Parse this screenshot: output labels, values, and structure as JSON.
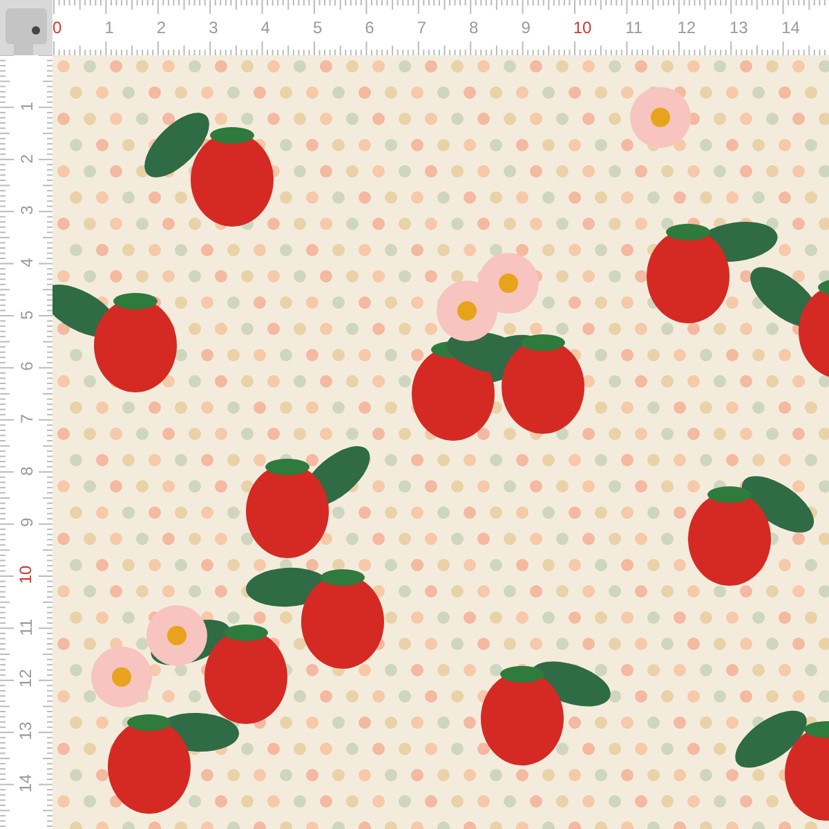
{
  "ruler_top": {
    "marks": [
      {
        "label": "0",
        "highlighted": true
      },
      {
        "label": "1",
        "highlighted": false
      },
      {
        "label": "2",
        "highlighted": false
      },
      {
        "label": "3",
        "highlighted": false
      },
      {
        "label": "4",
        "highlighted": false
      },
      {
        "label": "5",
        "highlighted": false
      },
      {
        "label": "6",
        "highlighted": false
      },
      {
        "label": "7",
        "highlighted": false
      },
      {
        "label": "8",
        "highlighted": false
      },
      {
        "label": "9",
        "highlighted": false
      },
      {
        "label": "10",
        "highlighted": true
      },
      {
        "label": "11",
        "highlighted": false
      },
      {
        "label": "12",
        "highlighted": false
      },
      {
        "label": "13",
        "highlighted": false
      },
      {
        "label": "14",
        "highlighted": false
      }
    ]
  },
  "ruler_left": {
    "marks": [
      {
        "label": "1",
        "highlighted": false
      },
      {
        "label": "2",
        "highlighted": false
      },
      {
        "label": "3",
        "highlighted": false
      },
      {
        "label": "4",
        "highlighted": false
      },
      {
        "label": "5",
        "highlighted": false
      },
      {
        "label": "6",
        "highlighted": false
      },
      {
        "label": "7",
        "highlighted": false
      },
      {
        "label": "8",
        "highlighted": false
      },
      {
        "label": "9",
        "highlighted": false
      },
      {
        "label": "10",
        "highlighted": true
      },
      {
        "label": "11",
        "highlighted": false
      },
      {
        "label": "12",
        "highlighted": false
      },
      {
        "label": "13",
        "highlighted": false
      },
      {
        "label": "14",
        "highlighted": false
      }
    ]
  }
}
